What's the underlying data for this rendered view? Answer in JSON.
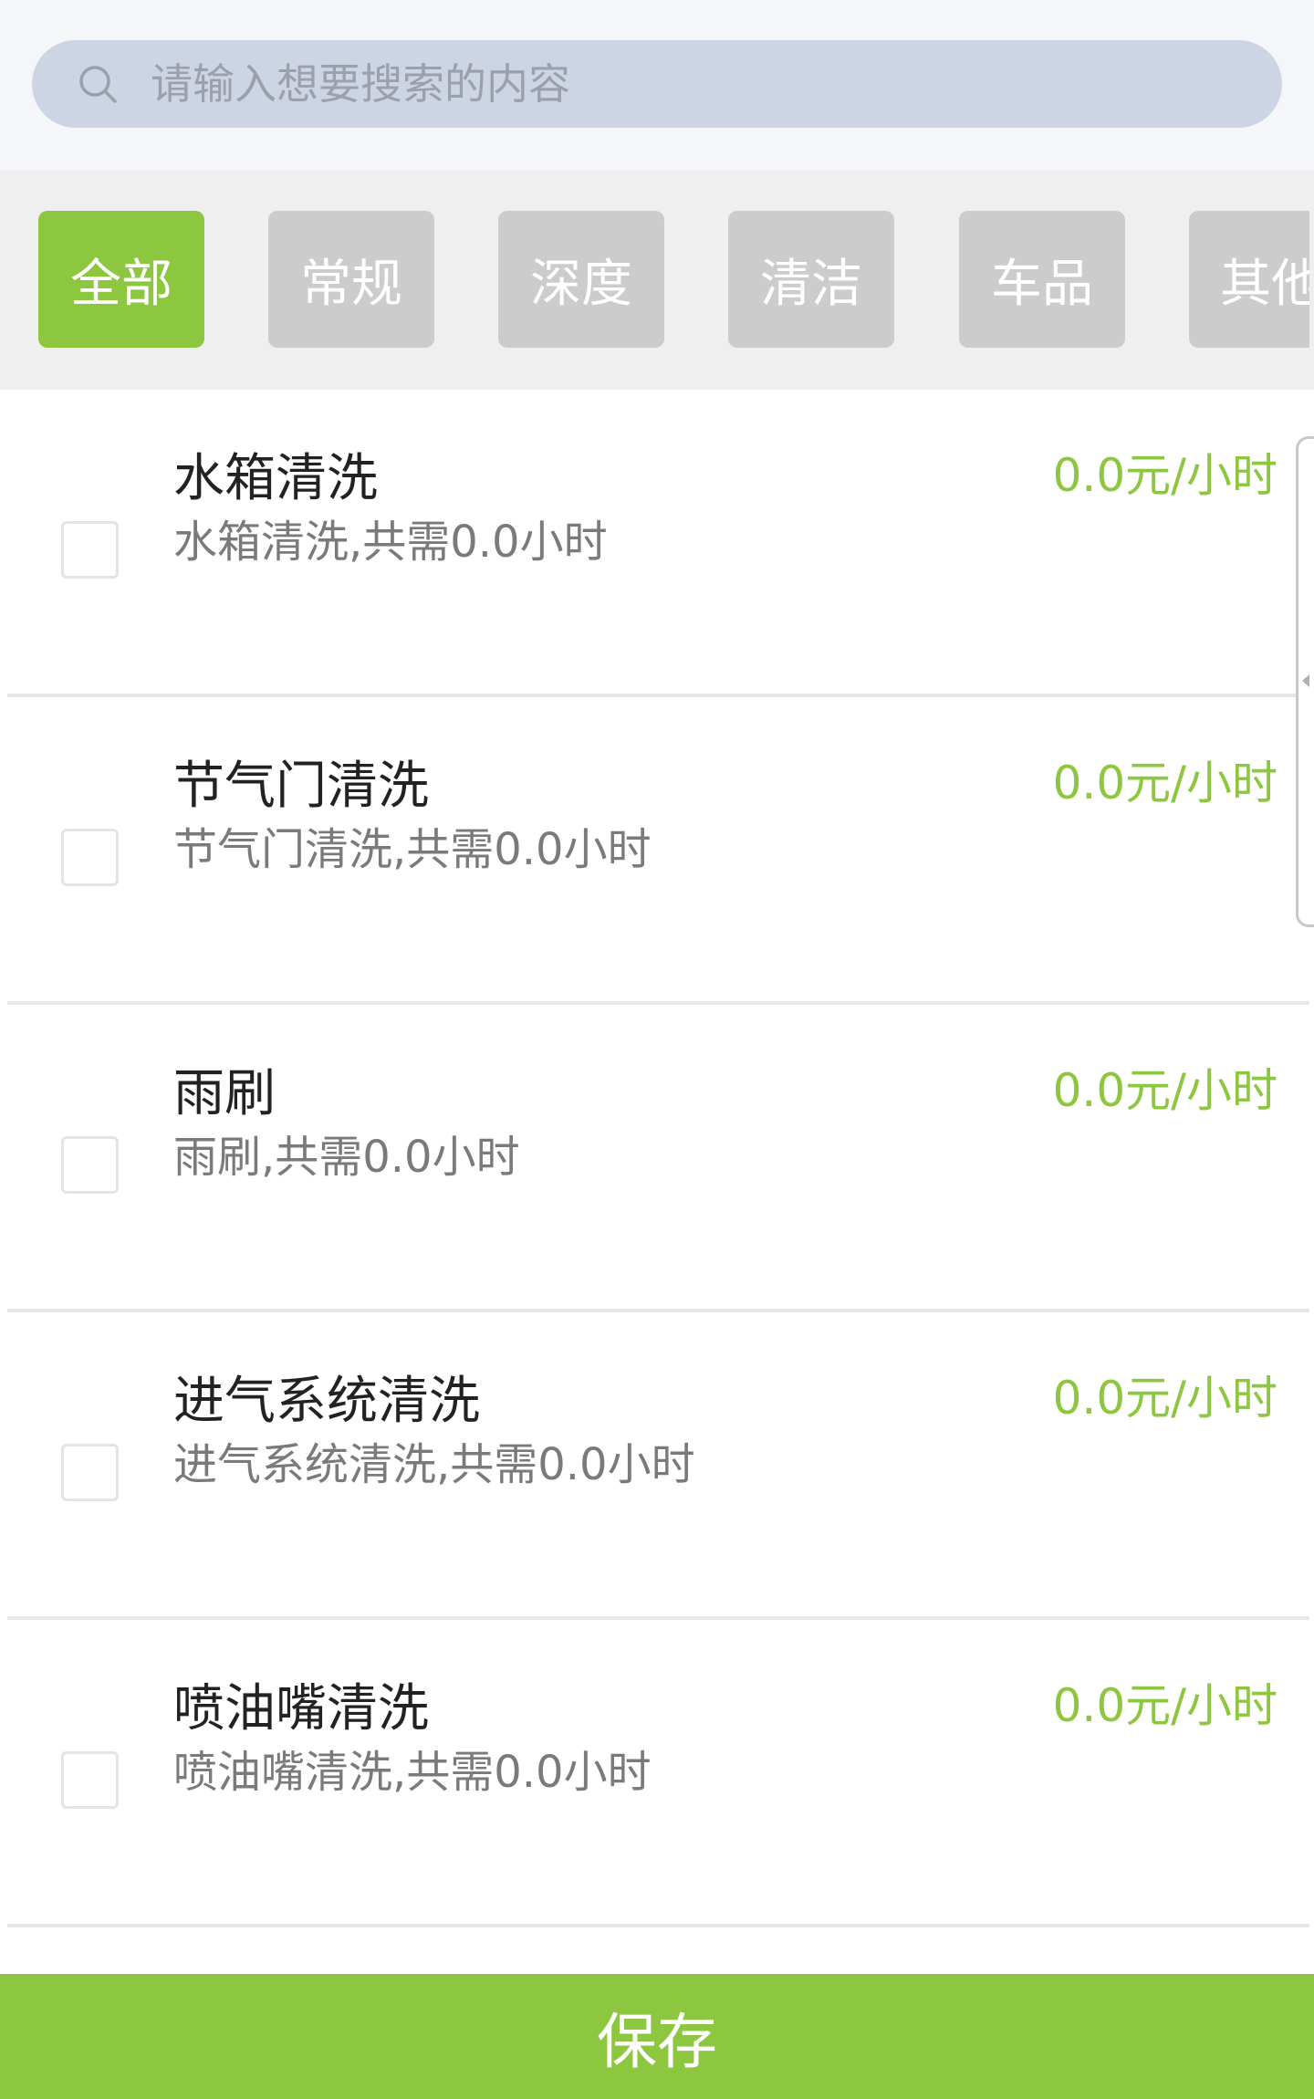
{
  "search": {
    "placeholder": "请输入想要搜索的内容",
    "icon": "search-icon"
  },
  "tabs": [
    {
      "label": "全部",
      "active": true
    },
    {
      "label": "常规",
      "active": false
    },
    {
      "label": "深度",
      "active": false
    },
    {
      "label": "清洁",
      "active": false
    },
    {
      "label": "车品",
      "active": false
    },
    {
      "label": "其他",
      "active": false
    }
  ],
  "items": [
    {
      "title": "水箱清洗",
      "desc": "水箱清洗,共需0.0小时",
      "price": "0.0元/小时"
    },
    {
      "title": "节气门清洗",
      "desc": "节气门清洗,共需0.0小时",
      "price": "0.0元/小时"
    },
    {
      "title": "雨刷",
      "desc": "雨刷,共需0.0小时",
      "price": "0.0元/小时"
    },
    {
      "title": "进气系统清洗",
      "desc": "进气系统清洗,共需0.0小时",
      "price": "0.0元/小时"
    },
    {
      "title": "喷油嘴清洗",
      "desc": "喷油嘴清洗,共需0.0小时",
      "price": "0.0元/小时"
    }
  ],
  "footer": {
    "save_label": "保存"
  },
  "colors": {
    "accent": "#8dc63f",
    "tab_inactive": "#cccccc",
    "search_bg": "#cdd4e3"
  }
}
